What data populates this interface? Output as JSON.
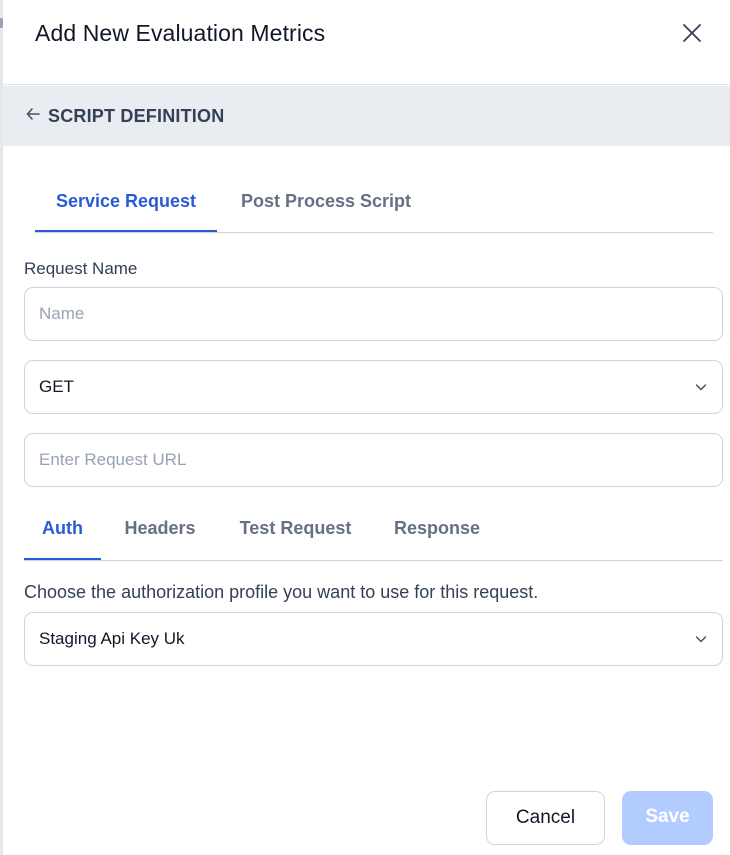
{
  "dialog": {
    "title": "Add New Evaluation Metrics",
    "close_icon": "close-icon"
  },
  "section": {
    "title": "SCRIPT DEFINITION",
    "back_icon": "arrow-left-icon"
  },
  "main_tabs": [
    {
      "label": "Service Request",
      "active": true
    },
    {
      "label": "Post Process Script",
      "active": false
    }
  ],
  "request": {
    "name_label": "Request Name",
    "name_placeholder": "Name",
    "name_value": "",
    "method": "GET",
    "url_placeholder": "Enter Request URL",
    "url_value": ""
  },
  "sub_tabs": [
    {
      "label": "Auth",
      "active": true
    },
    {
      "label": "Headers",
      "active": false
    },
    {
      "label": "Test Request",
      "active": false
    },
    {
      "label": "Response",
      "active": false
    }
  ],
  "auth": {
    "description": "Choose the authorization profile you want to use for this request.",
    "profile": "Staging Api Key Uk"
  },
  "footer": {
    "cancel_label": "Cancel",
    "save_label": "Save"
  },
  "colors": {
    "accent": "#2a5bd7",
    "save_disabled": "#b2ccff",
    "section_bg": "#e9ecf0"
  }
}
